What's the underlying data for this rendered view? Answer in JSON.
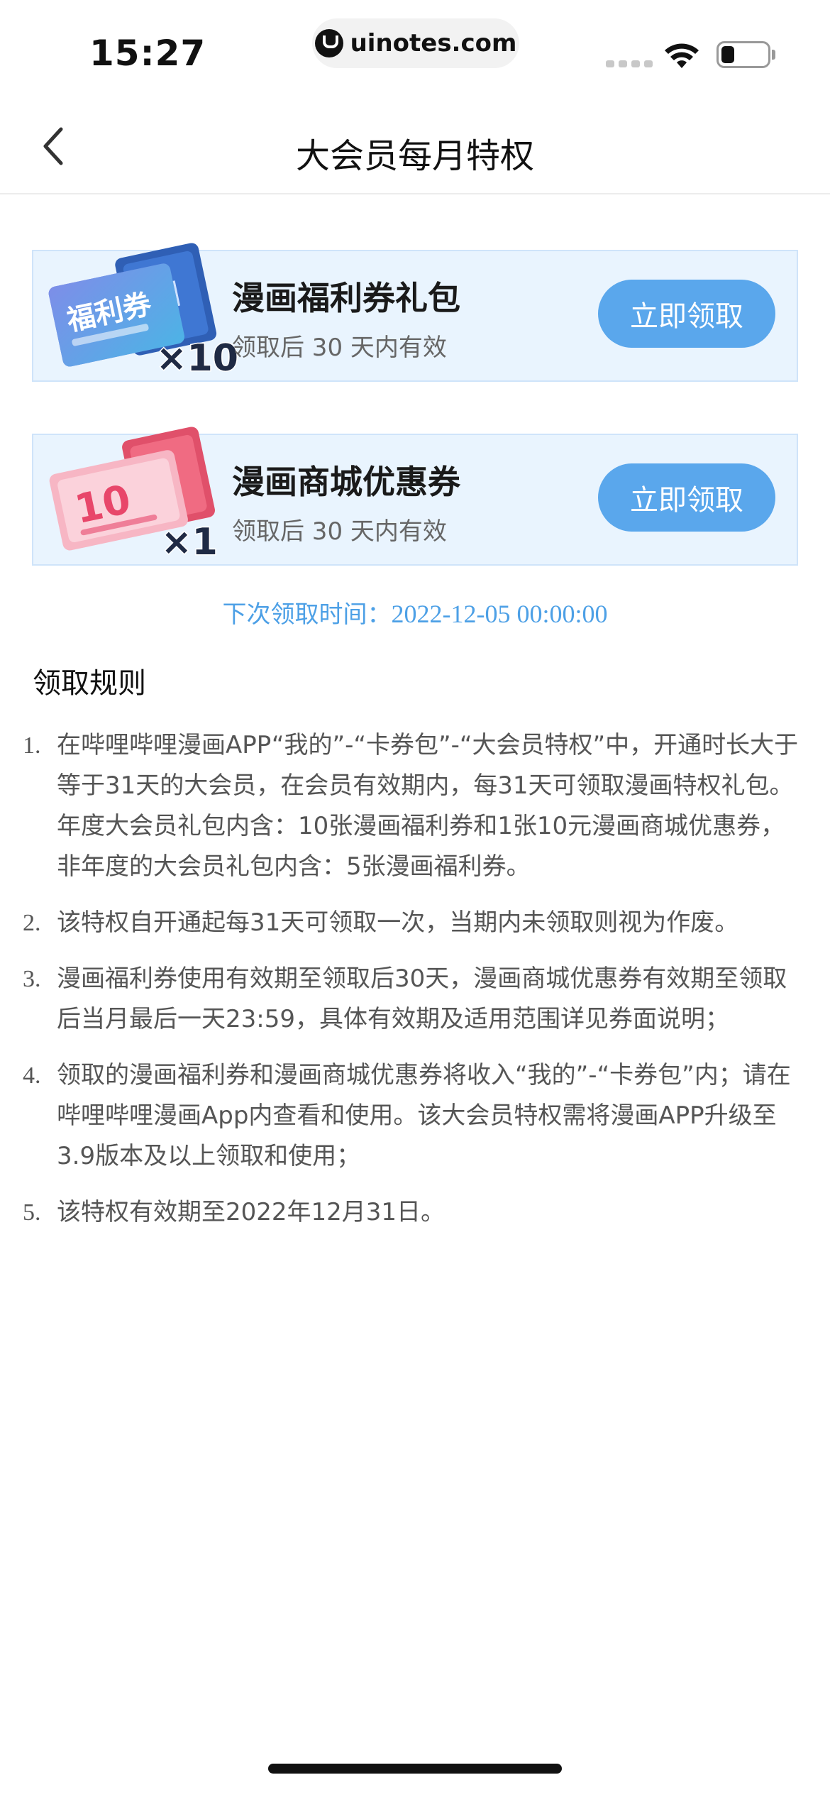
{
  "status_bar": {
    "time": "15:27",
    "url": "uinotes.com"
  },
  "nav": {
    "title": "大会员每月特权"
  },
  "cards": [
    {
      "badge": "福利券",
      "multiplier": "×10",
      "title": "漫画福利券礼包",
      "subtitle": "领取后 30 天内有效",
      "button": "立即领取"
    },
    {
      "badge": "10",
      "multiplier": "×1",
      "title": "漫画商城优惠券",
      "subtitle": "领取后 30 天内有效",
      "button": "立即领取"
    }
  ],
  "next_claim": {
    "label": "下次领取时间：",
    "value": "2022-12-05 00:00:00"
  },
  "rules": {
    "title": "领取规则",
    "items": [
      {
        "num": "1.",
        "text": "在哔哩哔哩漫画APP“我的”-“卡券包”-“大会员特权”中，开通时长大于等于31天的大会员，在会员有效期内，每31天可领取漫画特权礼包。年度大会员礼包内含：10张漫画福利券和1张10元漫画商城优惠券，非年度的大会员礼包内含：5张漫画福利券。"
      },
      {
        "num": "2.",
        "text": "该特权自开通起每31天可领取一次，当期内未领取则视为作废。"
      },
      {
        "num": "3.",
        "text": "漫画福利券使用有效期至领取后30天，漫画商城优惠券有效期至领取后当月最后一天23:59，具体有效期及适用范围详见券面说明；"
      },
      {
        "num": "4.",
        "text": "领取的漫画福利券和漫画商城优惠券将收入“我的”-“卡券包”内；请在哔哩哔哩漫画App内查看和使用。该大会员特权需将漫画APP升级至3.9版本及以上领取和使用；"
      },
      {
        "num": "5.",
        "text": "该特权有效期至2022年12月31日。"
      }
    ]
  },
  "colors": {
    "accent": "#5aa7ec",
    "card_bg": "#e9f4fe",
    "link_text": "#4da0e6"
  }
}
